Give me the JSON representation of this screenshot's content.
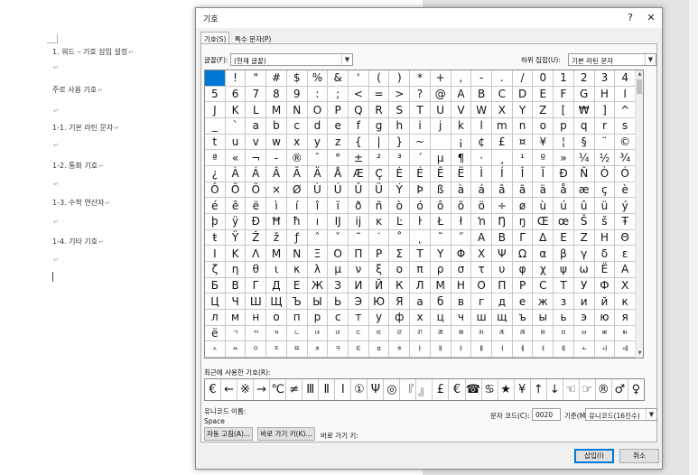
{
  "document": {
    "lines": [
      "1. 워드 – 기호 삽입 설정",
      "",
      "주로 사용 기호",
      "",
      "1-1. 기본 라틴 문자",
      "",
      "1-2. 통화 기호",
      "",
      "1-3. 수학 연산자",
      "",
      "1-4. 기타 기호",
      ""
    ],
    "para_mark": "↵"
  },
  "dialog": {
    "title": "기호",
    "help": "?",
    "close": "✕",
    "tabs": [
      "기호(S)",
      "특수 문자(P)"
    ],
    "font_label": "글꼴(F):",
    "font_value": "(현재 글꼴)",
    "subset_label": "하위 집합(U):",
    "subset_value": "기본 라틴 문자",
    "symbols": [
      " ",
      "!",
      "\"",
      "#",
      "$",
      "%",
      "&",
      "'",
      "(",
      ")",
      "*",
      "+",
      ",",
      "-",
      ".",
      "/",
      "0",
      "1",
      "2",
      "3",
      "4",
      "5",
      "6",
      "7",
      "8",
      "9",
      ":",
      ";",
      "<",
      "=",
      ">",
      "?",
      "@",
      "A",
      "B",
      "C",
      "D",
      "E",
      "F",
      "G",
      "H",
      "I",
      "J",
      "K",
      "L",
      "M",
      "N",
      "O",
      "P",
      "Q",
      "R",
      "S",
      "T",
      "U",
      "V",
      "W",
      "X",
      "Y",
      "Z",
      "[",
      "₩",
      "]",
      "^",
      "_",
      "`",
      "a",
      "b",
      "c",
      "d",
      "e",
      "f",
      "g",
      "h",
      "i",
      "j",
      "k",
      "l",
      "m",
      "n",
      "o",
      "p",
      "q",
      "r",
      "s",
      "t",
      "u",
      "v",
      "w",
      "x",
      "y",
      "z",
      "{",
      "|",
      "}",
      "~",
      "",
      "¡",
      "¢",
      "£",
      "¤",
      "¥",
      "¦",
      "§",
      "¨",
      "©",
      "ª",
      "«",
      "¬",
      "-",
      "®",
      "¯",
      "°",
      "±",
      "²",
      "³",
      "´",
      "µ",
      "¶",
      "·",
      "¸",
      "¹",
      "º",
      "»",
      "¼",
      "½",
      "¾",
      "¿",
      "À",
      "Á",
      "Â",
      "Ã",
      "Ä",
      "Å",
      "Æ",
      "Ç",
      "È",
      "É",
      "Ê",
      "Ë",
      "Ì",
      "Í",
      "Î",
      "Ï",
      "Ð",
      "Ñ",
      "Ò",
      "Ó",
      "Ô",
      "Õ",
      "Ö",
      "×",
      "Ø",
      "Ù",
      "Ú",
      "Û",
      "Ü",
      "Ý",
      "Þ",
      "ß",
      "à",
      "á",
      "â",
      "ã",
      "ä",
      "å",
      "æ",
      "ç",
      "è",
      "é",
      "ê",
      "ë",
      "ì",
      "í",
      "î",
      "ï",
      "ð",
      "ñ",
      "ò",
      "ó",
      "ô",
      "õ",
      "ö",
      "÷",
      "ø",
      "ù",
      "ú",
      "û",
      "ü",
      "ý",
      "þ",
      "ÿ",
      "Đ",
      "Ħ",
      "ħ",
      "ı",
      "Ĳ",
      "ĳ",
      "ĸ",
      "Ŀ",
      "ŀ",
      "Ł",
      "ł",
      "ŉ",
      "Ŋ",
      "ŋ",
      "Œ",
      "œ",
      "Š",
      "š",
      "Ŧ",
      "ŧ",
      "Ÿ",
      "Ž",
      "ž",
      "ƒ",
      "ˆ",
      "ˇ",
      "˘",
      "˙",
      "˚",
      "˛",
      "˜",
      "˝",
      "Α",
      "Β",
      "Γ",
      "Δ",
      "Ε",
      "Ζ",
      "Η",
      "Θ",
      "Ι",
      "Κ",
      "Λ",
      "Μ",
      "Ν",
      "Ξ",
      "Ο",
      "Π",
      "Ρ",
      "Σ",
      "Τ",
      "Υ",
      "Φ",
      "Χ",
      "Ψ",
      "Ω",
      "α",
      "β",
      "γ",
      "δ",
      "ε",
      "ζ",
      "η",
      "θ",
      "ι",
      "κ",
      "λ",
      "μ",
      "ν",
      "ξ",
      "ο",
      "π",
      "ρ",
      "σ",
      "τ",
      "υ",
      "φ",
      "χ",
      "ψ",
      "ω",
      "Ё",
      "А",
      "Б",
      "В",
      "Г",
      "Д",
      "Е",
      "Ж",
      "З",
      "И",
      "Й",
      "К",
      "Л",
      "М",
      "Н",
      "О",
      "П",
      "Р",
      "С",
      "Т",
      "У",
      "Ф",
      "Х",
      "Ц",
      "Ч",
      "Ш",
      "Щ",
      "Ъ",
      "Ы",
      "Ь",
      "Э",
      "Ю",
      "Я",
      "а",
      "б",
      "в",
      "г",
      "д",
      "е",
      "ж",
      "з",
      "и",
      "й",
      "к",
      "л",
      "м",
      "н",
      "о",
      "п",
      "р",
      "с",
      "т",
      "у",
      "ф",
      "х",
      "ц",
      "ч",
      "ш",
      "щ",
      "ъ",
      "ы",
      "ь",
      "э",
      "ю",
      "я",
      "ё",
      "ㄱ",
      "ㄲ",
      "ㄳ",
      "ㄴ",
      "ㄵ",
      "ㄶ",
      "ㄷ",
      "ㄸ",
      "ㄹ",
      "ㄺ",
      "ㄻ",
      "ㄼ",
      "ㄽ",
      "ㄾ",
      "ㄿ",
      "ㅀ",
      "ㅁ",
      "ㅂ",
      "ㅃ",
      "ㅄ",
      "ㅅ",
      "ㅆ",
      "ㅇ",
      "ㅈ",
      "ㅉ",
      "ㅊ",
      "ㅋ",
      "ㅌ",
      "ㅍ",
      "ㅎ",
      "ㅏ",
      "ㅐ",
      "ㅑ",
      "ㅒ",
      "ㅓ",
      "ㅔ",
      "ㅕ",
      "ㅖ",
      "ㅗ",
      "ㅘ",
      "ㅙ",
      "ㅚ",
      "ㅛ",
      "ㅜ",
      "ㅝ",
      "ㅞ",
      "ㅟ",
      "ㅠ",
      "ㅡ",
      "ㅢ",
      "ㅣ",
      "ㅤ",
      "ㅥ",
      "ㅦ",
      "ㅧ",
      "ㅨ",
      "ㅩ",
      "ㅪ",
      "ㅫ",
      "ㅬ",
      "ㅭ",
      "ㅮ",
      "ㅯ",
      "ㅰ",
      "ㅱ",
      "ㅲ",
      "ㅳ",
      "ㅴ",
      "ㅵ",
      "ㅶ",
      "ㅷ",
      "ㅸ",
      "ㅹ",
      "ㅺ",
      "ㅻ",
      "ㅼ",
      "ㅽ",
      "ㅾ",
      "ㅿ",
      "ㆀ",
      "ㆁ",
      "ㆂ",
      "ㆃ",
      "ㆄ",
      "ㆅ",
      "ㆆ",
      "ㆇ",
      "ㆈ",
      "ㆉ",
      "ㆊ",
      "ㆋ",
      "ㆌ",
      "ㆍ",
      "ㆎ",
      "ᄑ",
      "",
      "ᅡ",
      "ᅢ",
      "ᅣ",
      "ᅤ",
      "ᅥ",
      "ᅦ",
      "ᅧ",
      "ᅨ",
      "ᅩ",
      "ᅪ",
      "ᅫ",
      "ᅬ",
      "ᅭ",
      "ᅮ",
      "ᅯ",
      "ᅰ",
      "ᅱ",
      "ᅲ",
      "ᅳ",
      "ᅴ",
      "ᅵ",
      "ᆨ",
      "ᆩ",
      "ᆪ",
      "ᆫ"
    ],
    "recent_label": "최근에 사용한 기호(R):",
    "recent": [
      "€",
      "←",
      "※",
      "→",
      "℃",
      "≠",
      "Ⅲ",
      "Ⅱ",
      "Ⅰ",
      "①",
      "Ψ",
      "◎",
      "『",
      "』",
      "£",
      "€",
      "☎",
      "♋",
      "★",
      "¥",
      "↑",
      "↓",
      "☜",
      "☞",
      "®",
      "♂",
      "♀"
    ],
    "unicode_name_label": "유니코드 이름:",
    "unicode_name": "Space",
    "char_code_label": "문자 코드(C):",
    "char_code": "0020",
    "from_label": "기준(M):",
    "from_value": "유니코드(16진수)",
    "autocorrect_btn": "자동 고침(A)...",
    "shortcut_btn": "바로 가기 키(K)...",
    "shortcut_label": "바로 가기 키:",
    "insert_btn": "삽입(I)",
    "cancel_btn": "취소"
  },
  "colors": {
    "selection": "#0078d7"
  }
}
